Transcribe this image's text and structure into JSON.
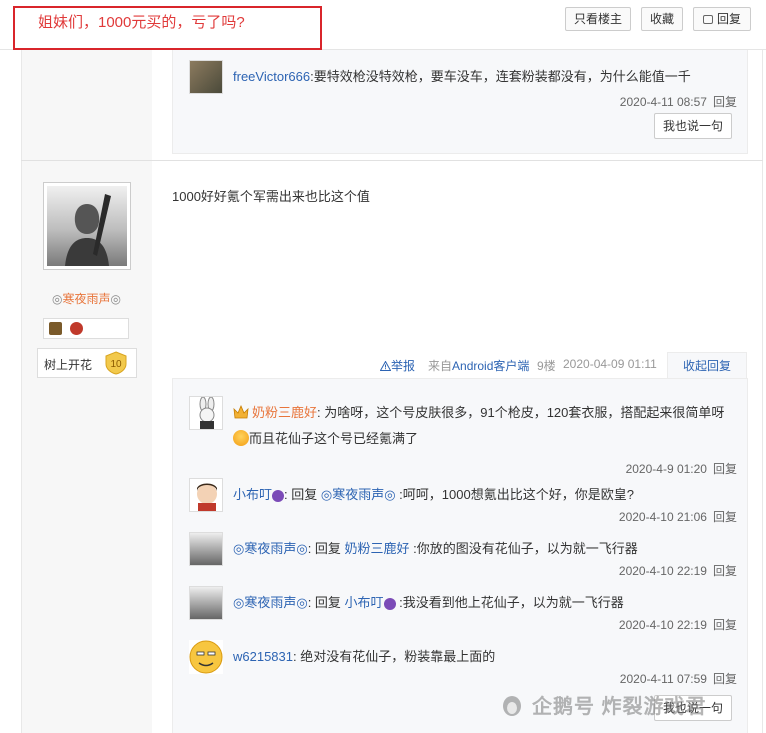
{
  "header": {
    "title": "姐妹们，1000元买的，亏了吗?",
    "btn_only_author": "只看楼主",
    "btn_collect": "收藏",
    "btn_reply": "回复"
  },
  "top_lzl": {
    "item": {
      "user": "freeVictor666",
      "text": ":要特效枪没特效枪，要车没车，连套粉装都没有，为什么能值一千",
      "date": "2020-4-11 08:57",
      "reply": "回复"
    },
    "say_button": "我也说一句"
  },
  "post": {
    "author": {
      "name_mark_left": "◎",
      "name": "寒夜雨声",
      "name_mark_right": "◎",
      "level_name": "树上开花",
      "level_num": "10"
    },
    "content": "1000好好氪个军需出来也比这个值",
    "tail": {
      "report": "举报",
      "from_prefix": "来自",
      "from_client": "Android客户端",
      "floor": "9楼",
      "date": "2020-04-09 01:11",
      "collapse": "收起回复"
    }
  },
  "lzl": [
    {
      "user": "奶粉三鹿好",
      "text_a": ": 为啥呀，这个号皮肤很多，91个枪皮，120套衣服，搭配起来很简单呀",
      "text_b": "而且花仙子这个号已经氪满了",
      "date": "2020-4-9 01:20",
      "reply": "回复"
    },
    {
      "user": "小布叮",
      "mid": ": 回复 ",
      "target": "◎寒夜雨声◎",
      "text": " :呵呵，1000想氪出比这个好，你是欧皇?",
      "date": "2020-4-10 21:06",
      "reply": "回复"
    },
    {
      "user": "◎寒夜雨声◎",
      "mid": ": 回复 ",
      "target": "奶粉三鹿好",
      "text": " :你放的图没有花仙子，以为就一飞行器",
      "date": "2020-4-10 22:19",
      "reply": "回复"
    },
    {
      "user": "◎寒夜雨声◎",
      "mid": ": 回复 ",
      "target": "小布叮",
      "text": " :我没看到他上花仙子，以为就一飞行器",
      "date": "2020-4-10 22:19",
      "reply": "回复"
    },
    {
      "user": "w6215831",
      "text": ": 绝对没有花仙子，粉装靠最上面的",
      "date": "2020-4-11 07:59",
      "reply": "回复"
    }
  ],
  "say_button_bottom": "我也说一句",
  "watermark": "企鹅号 炸裂游戏君",
  "colors": {
    "title_red": "#e03a3a",
    "link_blue": "#2d64b3",
    "author_orange": "#e8753b"
  }
}
